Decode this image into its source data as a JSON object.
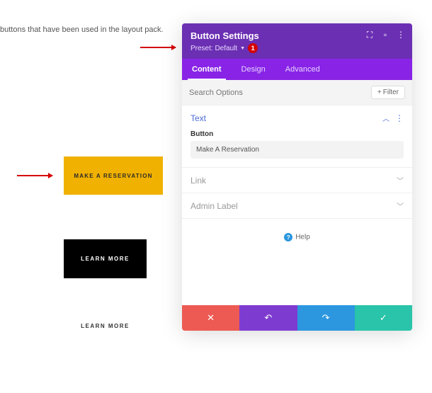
{
  "background": {
    "intro_text": "buttons that have been used in the layout pack.",
    "button_yellow": "MAKE A RESERVATION",
    "button_black": "LEARN MORE",
    "button_text": "LEARN MORE"
  },
  "annotations": {
    "badge_number": "1"
  },
  "panel": {
    "title": "Button Settings",
    "preset_label": "Preset: Default",
    "header_icons": {
      "expand": "⛶",
      "panel": "▫",
      "more": "⋮"
    },
    "tabs": {
      "content": "Content",
      "design": "Design",
      "advanced": "Advanced"
    },
    "search_placeholder": "Search Options",
    "filter_label": "Filter",
    "sections": {
      "text": {
        "title": "Text",
        "field_label": "Button",
        "field_value": "Make A Reservation"
      },
      "link": {
        "title": "Link"
      },
      "admin_label": {
        "title": "Admin Label"
      }
    },
    "help_label": "Help",
    "footer": {
      "close": "✕",
      "undo": "↶",
      "redo": "↷",
      "check": "✓"
    }
  }
}
